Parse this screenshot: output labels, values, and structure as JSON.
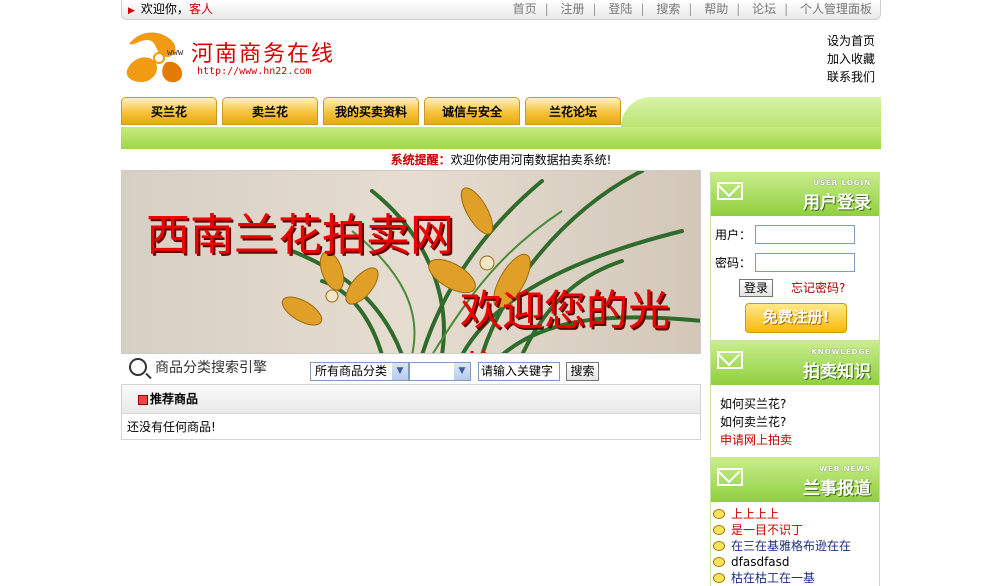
{
  "topbar": {
    "welcome_label": "欢迎你，",
    "guest_label": "客人",
    "nav": [
      "首页",
      "注册",
      "登陆",
      "搜索",
      "帮助",
      "论坛",
      "个人管理面板"
    ]
  },
  "logo": {
    "www": "www",
    "title": "河南商务在线",
    "url": "http://www.hn22.com"
  },
  "quick_links": [
    "设为首页",
    "加入收藏",
    "联系我们"
  ],
  "main_nav": [
    "买兰花",
    "卖兰花",
    "我的买卖资料",
    "诚信与安全",
    "兰花论坛"
  ],
  "notice": {
    "label": "系统提醒：",
    "text": "欢迎你使用河南数据拍卖系统!"
  },
  "banner": {
    "title": "西南兰花拍卖网",
    "welcome": "欢迎您的光临"
  },
  "search": {
    "label": "商品分类搜索引擎",
    "category_value": "所有商品分类",
    "subcategory_value": "",
    "keyword_value": "请输入关键字",
    "button_label": "搜索"
  },
  "recommend": {
    "title": "推荐商品",
    "empty_text": "还没有任何商品!"
  },
  "login_box": {
    "title_en": "USER LOGIN",
    "title_cn": "用户登录",
    "user_label": "用户：",
    "password_label": "密码：",
    "login_button": "登录",
    "forgot_label": "忘记密码?",
    "register_label": "免费注册!"
  },
  "knowledge_box": {
    "title_en": "KNOWLEDGE",
    "title_cn": "拍卖知识",
    "items": [
      "如何买兰花?",
      "如何卖兰花?",
      "申请网上拍卖"
    ]
  },
  "news_box": {
    "title_en": "WEB NEWS",
    "title_cn": "兰事报道",
    "items": [
      "上上上上",
      "是一目不识丁",
      "在三在基雅格布逊在在",
      "dfasdfasd",
      "枯在枯工在一基"
    ]
  }
}
